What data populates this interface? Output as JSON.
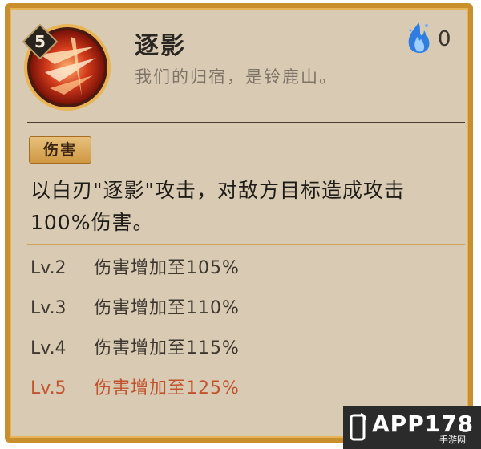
{
  "skill": {
    "level": "5",
    "name": "逐影",
    "flavor": "我们的归宿，是铃鹿山。",
    "cost_icon": "blue-soul-flame-icon",
    "cost": "0"
  },
  "tag": {
    "label": "伤害"
  },
  "description": {
    "line1": "以白刃\"逐影\"攻击，对敌方目标造成攻击",
    "line2": "100%伤害。"
  },
  "levels": [
    {
      "lv": "Lv.2",
      "text": "伤害增加至105%"
    },
    {
      "lv": "Lv.3",
      "text": "伤害增加至110%"
    },
    {
      "lv": "Lv.4",
      "text": "伤害增加至115%"
    },
    {
      "lv": "Lv.5",
      "text": "伤害增加至125%"
    }
  ],
  "watermark": {
    "main": "APP178",
    "sub": "手游网"
  },
  "colors": {
    "frame": "#c98f2c",
    "panel": "#d9cbb3",
    "highlight": "#c0532d",
    "soul_fire": "#2f7de0"
  }
}
